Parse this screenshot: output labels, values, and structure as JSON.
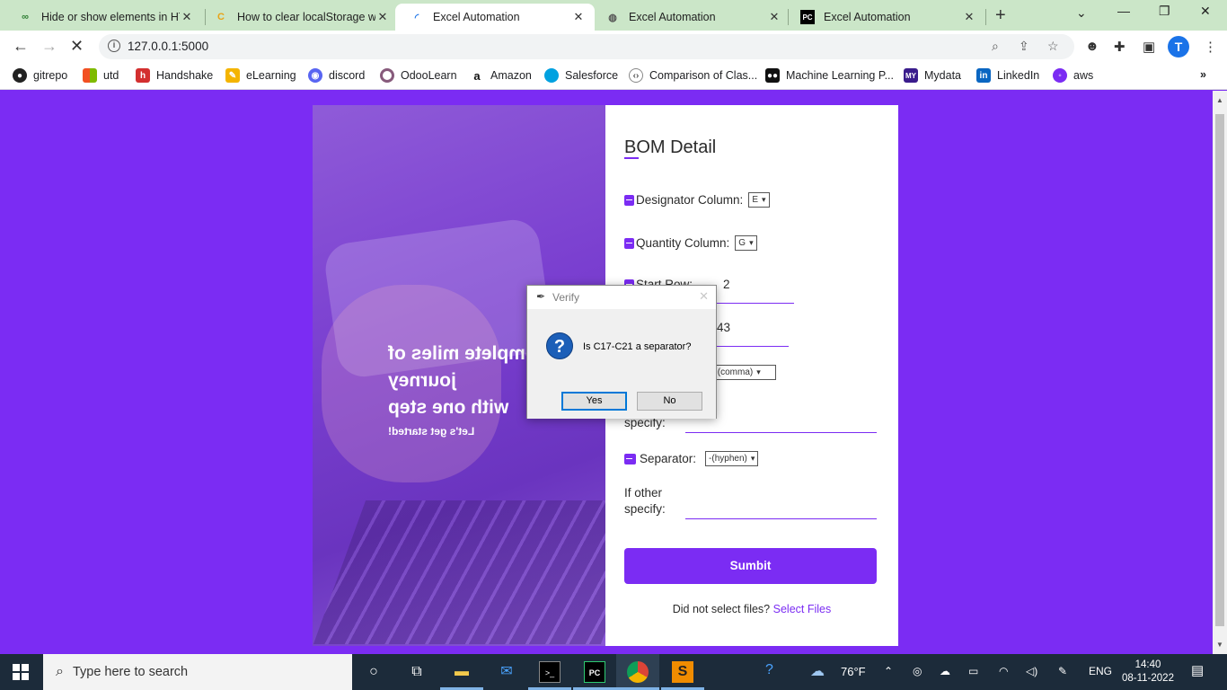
{
  "browser": {
    "tabs": [
      {
        "title": "Hide or show elements in HT",
        "active": false
      },
      {
        "title": "How to clear localStorage wh",
        "active": false
      },
      {
        "title": "Excel Automation",
        "active": true
      },
      {
        "title": "Excel Automation",
        "active": false
      },
      {
        "title": "Excel Automation",
        "active": false
      }
    ],
    "url": "127.0.0.1:5000",
    "profile_initial": "T",
    "bookmarks": [
      "gitrepo",
      "utd",
      "Handshake",
      "eLearning",
      "discord",
      "OdooLearn",
      "Amazon",
      "Salesforce",
      "Comparison of Clas...",
      "Machine Learning P...",
      "Mydata",
      "LinkedIn",
      "aws"
    ],
    "tab_colors": {
      "strip": "#cbe6c8",
      "active": "#ffffff"
    }
  },
  "hero": {
    "line1": "Complete miles of journey",
    "line2": "with one step",
    "line3": "Let's get started!"
  },
  "form": {
    "title": "BOM Detail",
    "designator_label": "Designator Column:",
    "designator_value": "E",
    "quantity_label": "Quantity Column:",
    "quantity_value": "G",
    "start_row_label": "Start Row:",
    "start_row_value": "2",
    "end_row_value": "43",
    "delimiter_value": ",(comma)",
    "other1_label_line2": "specify:",
    "separator_label": "Separator:",
    "separator_value": "-(hyphen)",
    "other2_label_line1": "If other",
    "other2_label_line2": "specify:",
    "submit_label": "Sumbit",
    "footer_text": "Did not select files?",
    "footer_link": "Select Files",
    "accent": "#7b2cf3"
  },
  "dialog": {
    "title": "Verify",
    "message": "Is C17-C21 a separator?",
    "yes": "Yes",
    "no": "No"
  },
  "taskbar": {
    "search_placeholder": "Type here to search",
    "weather": "76°F",
    "language": "ENG",
    "time": "14:40",
    "date": "08-11-2022"
  }
}
